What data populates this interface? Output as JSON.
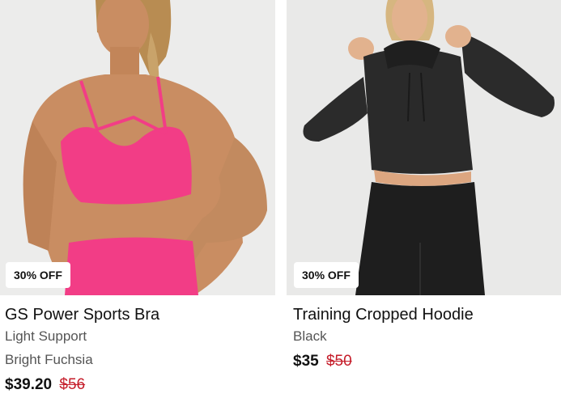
{
  "products": [
    {
      "badge": "30% OFF",
      "name": "GS Power Sports Bra",
      "lines": [
        "Light Support",
        "Bright Fuchsia"
      ],
      "price": "$39.20",
      "was_price": "$56",
      "image": "model-pink-sports-bra"
    },
    {
      "badge": "30% OFF",
      "name": "Training Cropped Hoodie",
      "lines": [
        "Black"
      ],
      "price": "$35",
      "was_price": "$50",
      "image": "model-black-cropped-hoodie"
    }
  ],
  "colors": {
    "sale": "#c51d2a",
    "bra": "#f23d86",
    "hoodie": "#2a2a2a"
  }
}
